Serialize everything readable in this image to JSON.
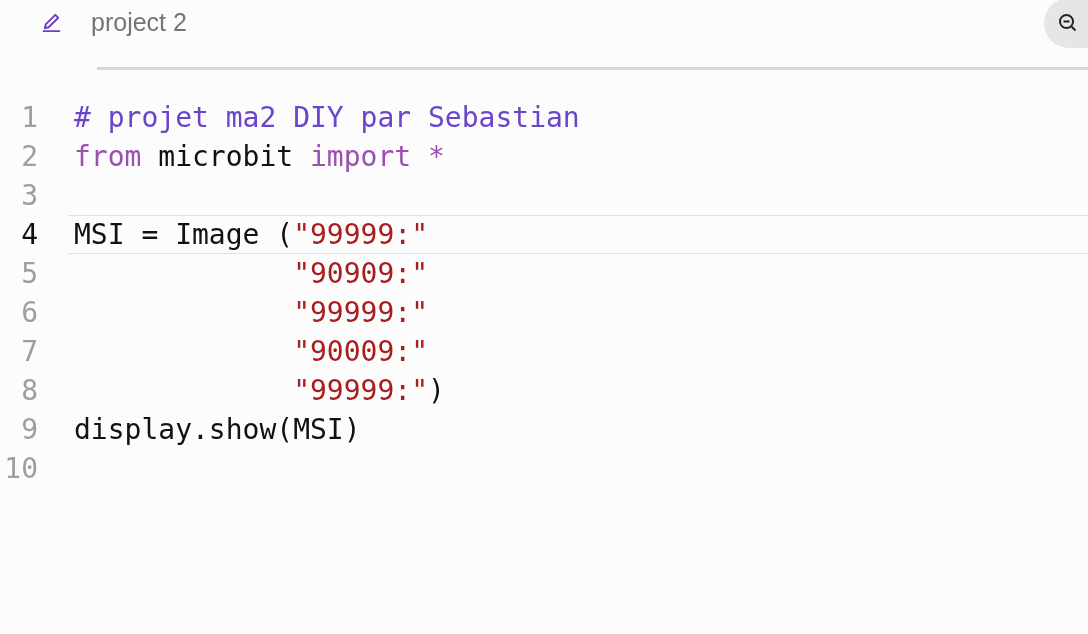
{
  "header": {
    "title": "project 2"
  },
  "editor": {
    "lines": [
      {
        "number": "1",
        "active": false,
        "tokens": [
          {
            "kind": "comment",
            "text": "# projet ma2 DIY par Sebastian"
          }
        ]
      },
      {
        "number": "2",
        "active": false,
        "tokens": [
          {
            "kind": "keyword",
            "text": "from"
          },
          {
            "kind": "plain",
            "text": " microbit "
          },
          {
            "kind": "keyword",
            "text": "import"
          },
          {
            "kind": "operator",
            "text": " *"
          }
        ]
      },
      {
        "number": "3",
        "active": false
      },
      {
        "number": "4",
        "active": true,
        "tokens": [
          {
            "kind": "plain",
            "text": "MSI = Image ("
          },
          {
            "kind": "string",
            "text": "\"99999:\""
          }
        ]
      },
      {
        "number": "5",
        "active": false,
        "tokens": [
          {
            "kind": "string",
            "text": "             \"90909:\""
          }
        ]
      },
      {
        "number": "6",
        "active": false,
        "tokens": [
          {
            "kind": "string",
            "text": "             \"99999:\""
          }
        ]
      },
      {
        "number": "7",
        "active": false,
        "tokens": [
          {
            "kind": "string",
            "text": "             \"90009:\""
          }
        ]
      },
      {
        "number": "8",
        "active": false,
        "tokens": [
          {
            "kind": "string",
            "text": "             \"99999:\""
          },
          {
            "kind": "plain",
            "text": ")"
          }
        ]
      },
      {
        "number": "9",
        "active": false,
        "tokens": [
          {
            "kind": "plain",
            "text": "display.show(MSI)"
          }
        ]
      },
      {
        "number": "10",
        "active": false
      }
    ]
  }
}
